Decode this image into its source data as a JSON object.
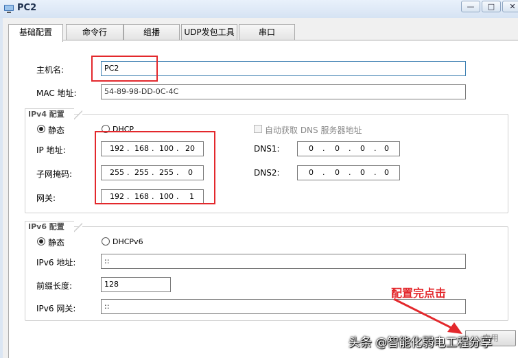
{
  "window": {
    "title": "PC2"
  },
  "tabs": [
    {
      "label": "基础配置"
    },
    {
      "label": "命令行"
    },
    {
      "label": "组播"
    },
    {
      "label": "UDP发包工具"
    },
    {
      "label": "串口"
    }
  ],
  "basic": {
    "hostname_label": "主机名:",
    "hostname_value": "PC2",
    "mac_label": "MAC 地址:",
    "mac_value": "54-89-98-DD-0C-4C"
  },
  "ipv4": {
    "group_title": "IPv4 配置",
    "static_label": "静态",
    "static_selected": true,
    "dhcp_label": "DHCP",
    "auto_dns_label": "自动获取 DNS 服务器地址",
    "auto_dns_checked": false,
    "ip_label": "IP 地址:",
    "ip": [
      "192",
      "168",
      "100",
      "20"
    ],
    "mask_label": "子网掩码:",
    "mask": [
      "255",
      "255",
      "255",
      "0"
    ],
    "gateway_label": "网关:",
    "gateway": [
      "192",
      "168",
      "100",
      "1"
    ],
    "dns1_label": "DNS1:",
    "dns1": [
      "0",
      "0",
      "0",
      "0"
    ],
    "dns2_label": "DNS2:",
    "dns2": [
      "0",
      "0",
      "0",
      "0"
    ]
  },
  "ipv6": {
    "group_title": "IPv6 配置",
    "static_label": "静态",
    "static_selected": true,
    "dhcp_label": "DHCPv6",
    "address_label": "IPv6 地址:",
    "address_value": "::",
    "prefix_label": "前缀长度:",
    "prefix_value": "128",
    "gateway_label": "IPv6 网关:",
    "gateway_value": "::"
  },
  "buttons": {
    "apply_label": "应用"
  },
  "annotation": {
    "text": "配置完点击",
    "color": "#e3282c"
  },
  "watermark": {
    "text": "头条 @智能化弱电工程分享"
  }
}
